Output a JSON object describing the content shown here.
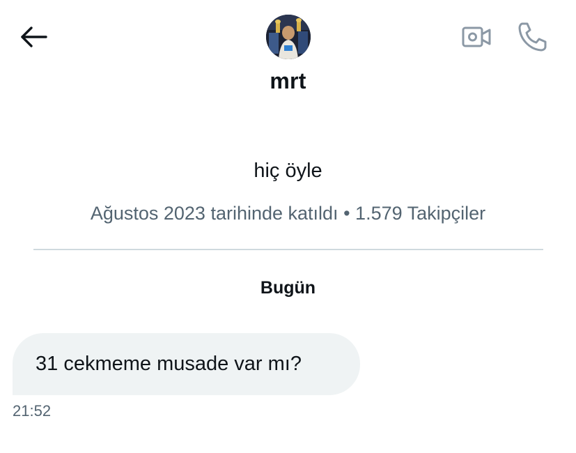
{
  "header": {
    "back_icon": "arrow-left-icon",
    "avatar_icon": "profile-photo",
    "name": "mrt",
    "video_icon": "video-camera-icon",
    "call_icon": "phone-icon"
  },
  "profile": {
    "bio": "hiç öyle",
    "joined": "Ağustos 2023 tarihinde katıldı",
    "separator": "•",
    "followers": "1.579 Takipçiler"
  },
  "conversation": {
    "day_label": "Bugün",
    "messages": [
      {
        "text": "31 cekmeme musade var mı?",
        "time": "21:52"
      }
    ]
  },
  "colors": {
    "text_primary": "#0f1419",
    "text_secondary": "#536471",
    "bubble_bg": "#eff3f4",
    "divider": "#cfd9de",
    "icon_gray": "#8b98a5"
  }
}
